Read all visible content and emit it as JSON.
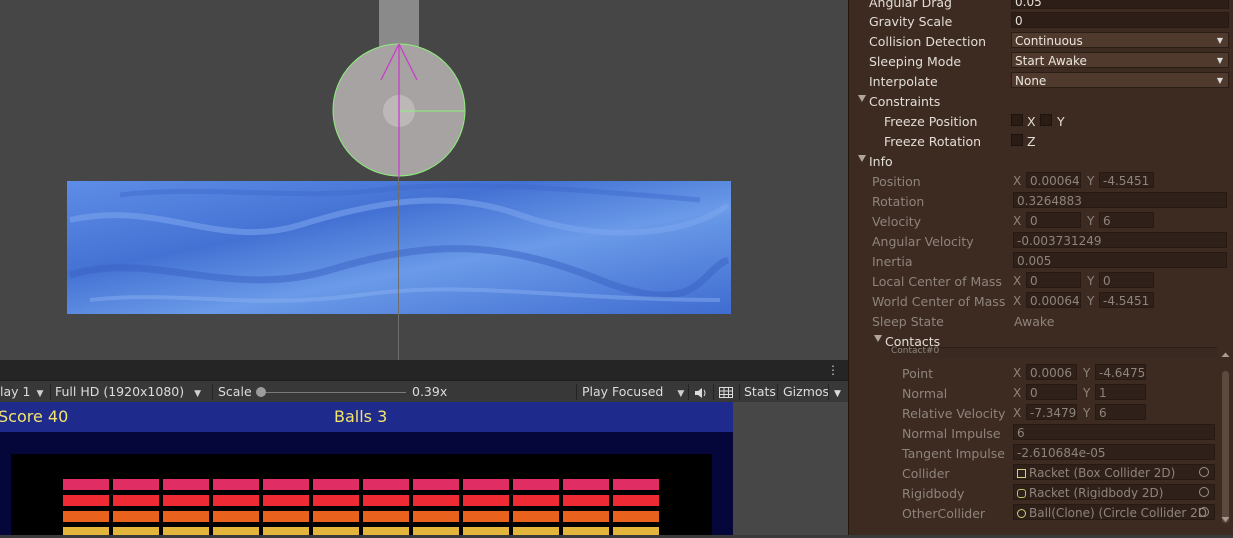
{
  "scene": {
    "background": "#464646",
    "water_color": "#4a78d6"
  },
  "game_tabbar": {
    "menu_glyph": "⋮"
  },
  "game_toolbar": {
    "display": "lay 1",
    "resolution": "Full HD (1920x1080)",
    "scale_label": "Scale",
    "scale_value": "0.39x",
    "scale_fraction": 0.03,
    "play_mode": "Play Focused",
    "stats": "Stats",
    "gizmos": "Gizmos"
  },
  "game": {
    "score_text": "Score 40",
    "balls_text": "Balls 3",
    "hud_color": "#1e2b8c",
    "text_color": "#f4e46a",
    "brick_colors": [
      "#e02d64",
      "#ee2b35",
      "#e8621e",
      "#e3b53a"
    ],
    "brick_columns": 12
  },
  "inspector": {
    "angular_drag_label": "Angular Drag",
    "angular_drag_value": "0.05",
    "gravity_scale_label": "Gravity Scale",
    "gravity_scale_value": "0",
    "collision_detection_label": "Collision Detection",
    "collision_detection_value": "Continuous",
    "sleeping_mode_label": "Sleeping Mode",
    "sleeping_mode_value": "Start Awake",
    "interpolate_label": "Interpolate",
    "interpolate_value": "None",
    "constraints_label": "Constraints",
    "freeze_position_label": "Freeze Position",
    "freeze_position_x": "X",
    "freeze_position_y": "Y",
    "freeze_rotation_label": "Freeze Rotation",
    "freeze_rotation_z": "Z",
    "info_label": "Info",
    "position_label": "Position",
    "position_x": "0.00064",
    "position_y": "-4.5451",
    "rotation_label": "Rotation",
    "rotation_value": "0.3264883",
    "velocity_label": "Velocity",
    "velocity_x": "0",
    "velocity_y": "6",
    "angular_velocity_label": "Angular Velocity",
    "angular_velocity_value": "-0.003731249",
    "inertia_label": "Inertia",
    "inertia_value": "0.005",
    "local_com_label": "Local Center of Mass",
    "local_com_x": "0",
    "local_com_y": "0",
    "world_com_label": "World Center of Mass",
    "world_com_x": "0.00064",
    "world_com_y": "-4.5451",
    "sleep_state_label": "Sleep State",
    "sleep_state_value": "Awake",
    "contacts_label": "Contacts",
    "contact0_label": "Contact#0",
    "point_label": "Point",
    "point_x": "0.0006",
    "point_y": "-4.6475",
    "normal_label": "Normal",
    "normal_x": "0",
    "normal_y": "1",
    "relative_velocity_label": "Relative Velocity",
    "relative_velocity_x": "-7.3479",
    "relative_velocity_y": "6",
    "normal_impulse_label": "Normal Impulse",
    "normal_impulse_value": "6",
    "tangent_impulse_label": "Tangent Impulse",
    "tangent_impulse_value": "-2.610684e-05",
    "collider_label": "Collider",
    "collider_value": "Racket (Box Collider 2D)",
    "rigidbody_label": "Rigidbody",
    "rigidbody_value": "Racket (Rigidbody 2D)",
    "other_collider_label": "OtherCollider",
    "other_collider_value": "Ball(Clone) (Circle Collider 2D",
    "axis_x": "X",
    "axis_y": "Y"
  }
}
